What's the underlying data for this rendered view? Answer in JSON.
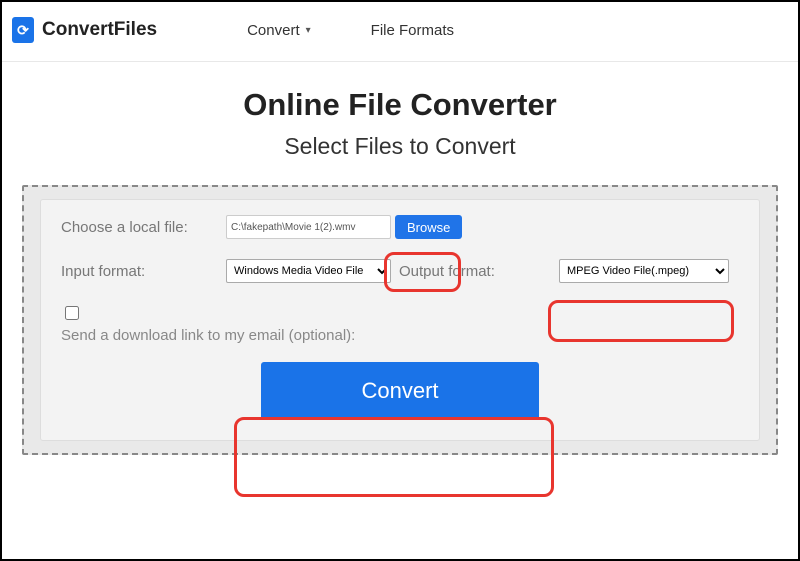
{
  "brand": {
    "name": "ConvertFiles"
  },
  "nav": {
    "convert": "Convert",
    "formats": "File Formats"
  },
  "main": {
    "title": "Online File Converter",
    "subtitle": "Select Files to Convert"
  },
  "form": {
    "chooseFileLabel": "Choose a local file:",
    "fileValue": "C:\\fakepath\\Movie 1(2).wmv",
    "browseLabel": "Browse",
    "inputFormatLabel": "Input format:",
    "inputFormatValue": "Windows Media Video File",
    "outputFormatLabel": "Output format:",
    "outputFormatValue": "MPEG Video File(.mpeg)",
    "emailCheckboxLabel": "Send a download link to my email (optional):",
    "convertLabel": "Convert"
  }
}
